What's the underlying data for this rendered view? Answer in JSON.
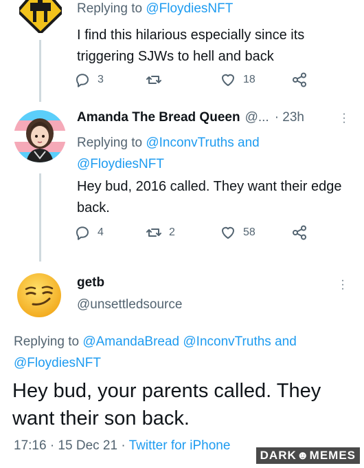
{
  "tweet1": {
    "replying_prefix": "Replying to ",
    "replying_handle": "@FloydiesNFT",
    "text": "I find this hilarious especially since its triggering SJWs to hell and back",
    "actions": {
      "replies": "3",
      "retweets": "",
      "likes": "18"
    }
  },
  "tweet2": {
    "name": "Amanda The Bread Queen",
    "handle": "@...",
    "time": "· 23h",
    "replying_prefix": "Replying to ",
    "replying_handle_1": "@InconvTruths",
    "replying_and": " and ",
    "replying_handle_2": "@FloydiesNFT",
    "text": "Hey bud, 2016 called. They want their edge back.",
    "actions": {
      "replies": "4",
      "retweets": "2",
      "likes": "58"
    }
  },
  "tweet3": {
    "name": "getb",
    "handle": "@unsettledsource",
    "replying_prefix": "Replying to ",
    "replying_handle_1": "@AmandaBread",
    "replying_handle_2": "@InconvTruths",
    "replying_and": " and ",
    "replying_handle_3": "@FloydiesNFT",
    "text": "Hey bud, your parents called. They want their son back.",
    "time": "17:16 · 15 Dec 21 · ",
    "client": "Twitter for iPhone"
  },
  "watermark": "DARK☻MEMES",
  "icons": {
    "reply": "reply-icon",
    "retweet": "retweet-icon",
    "like": "heart-icon",
    "share": "share-icon",
    "more": "more-icon"
  },
  "colors": {
    "link": "#1d9bf0",
    "muted": "#536471",
    "text": "#0f1419",
    "thread_line": "#cfd9de"
  }
}
